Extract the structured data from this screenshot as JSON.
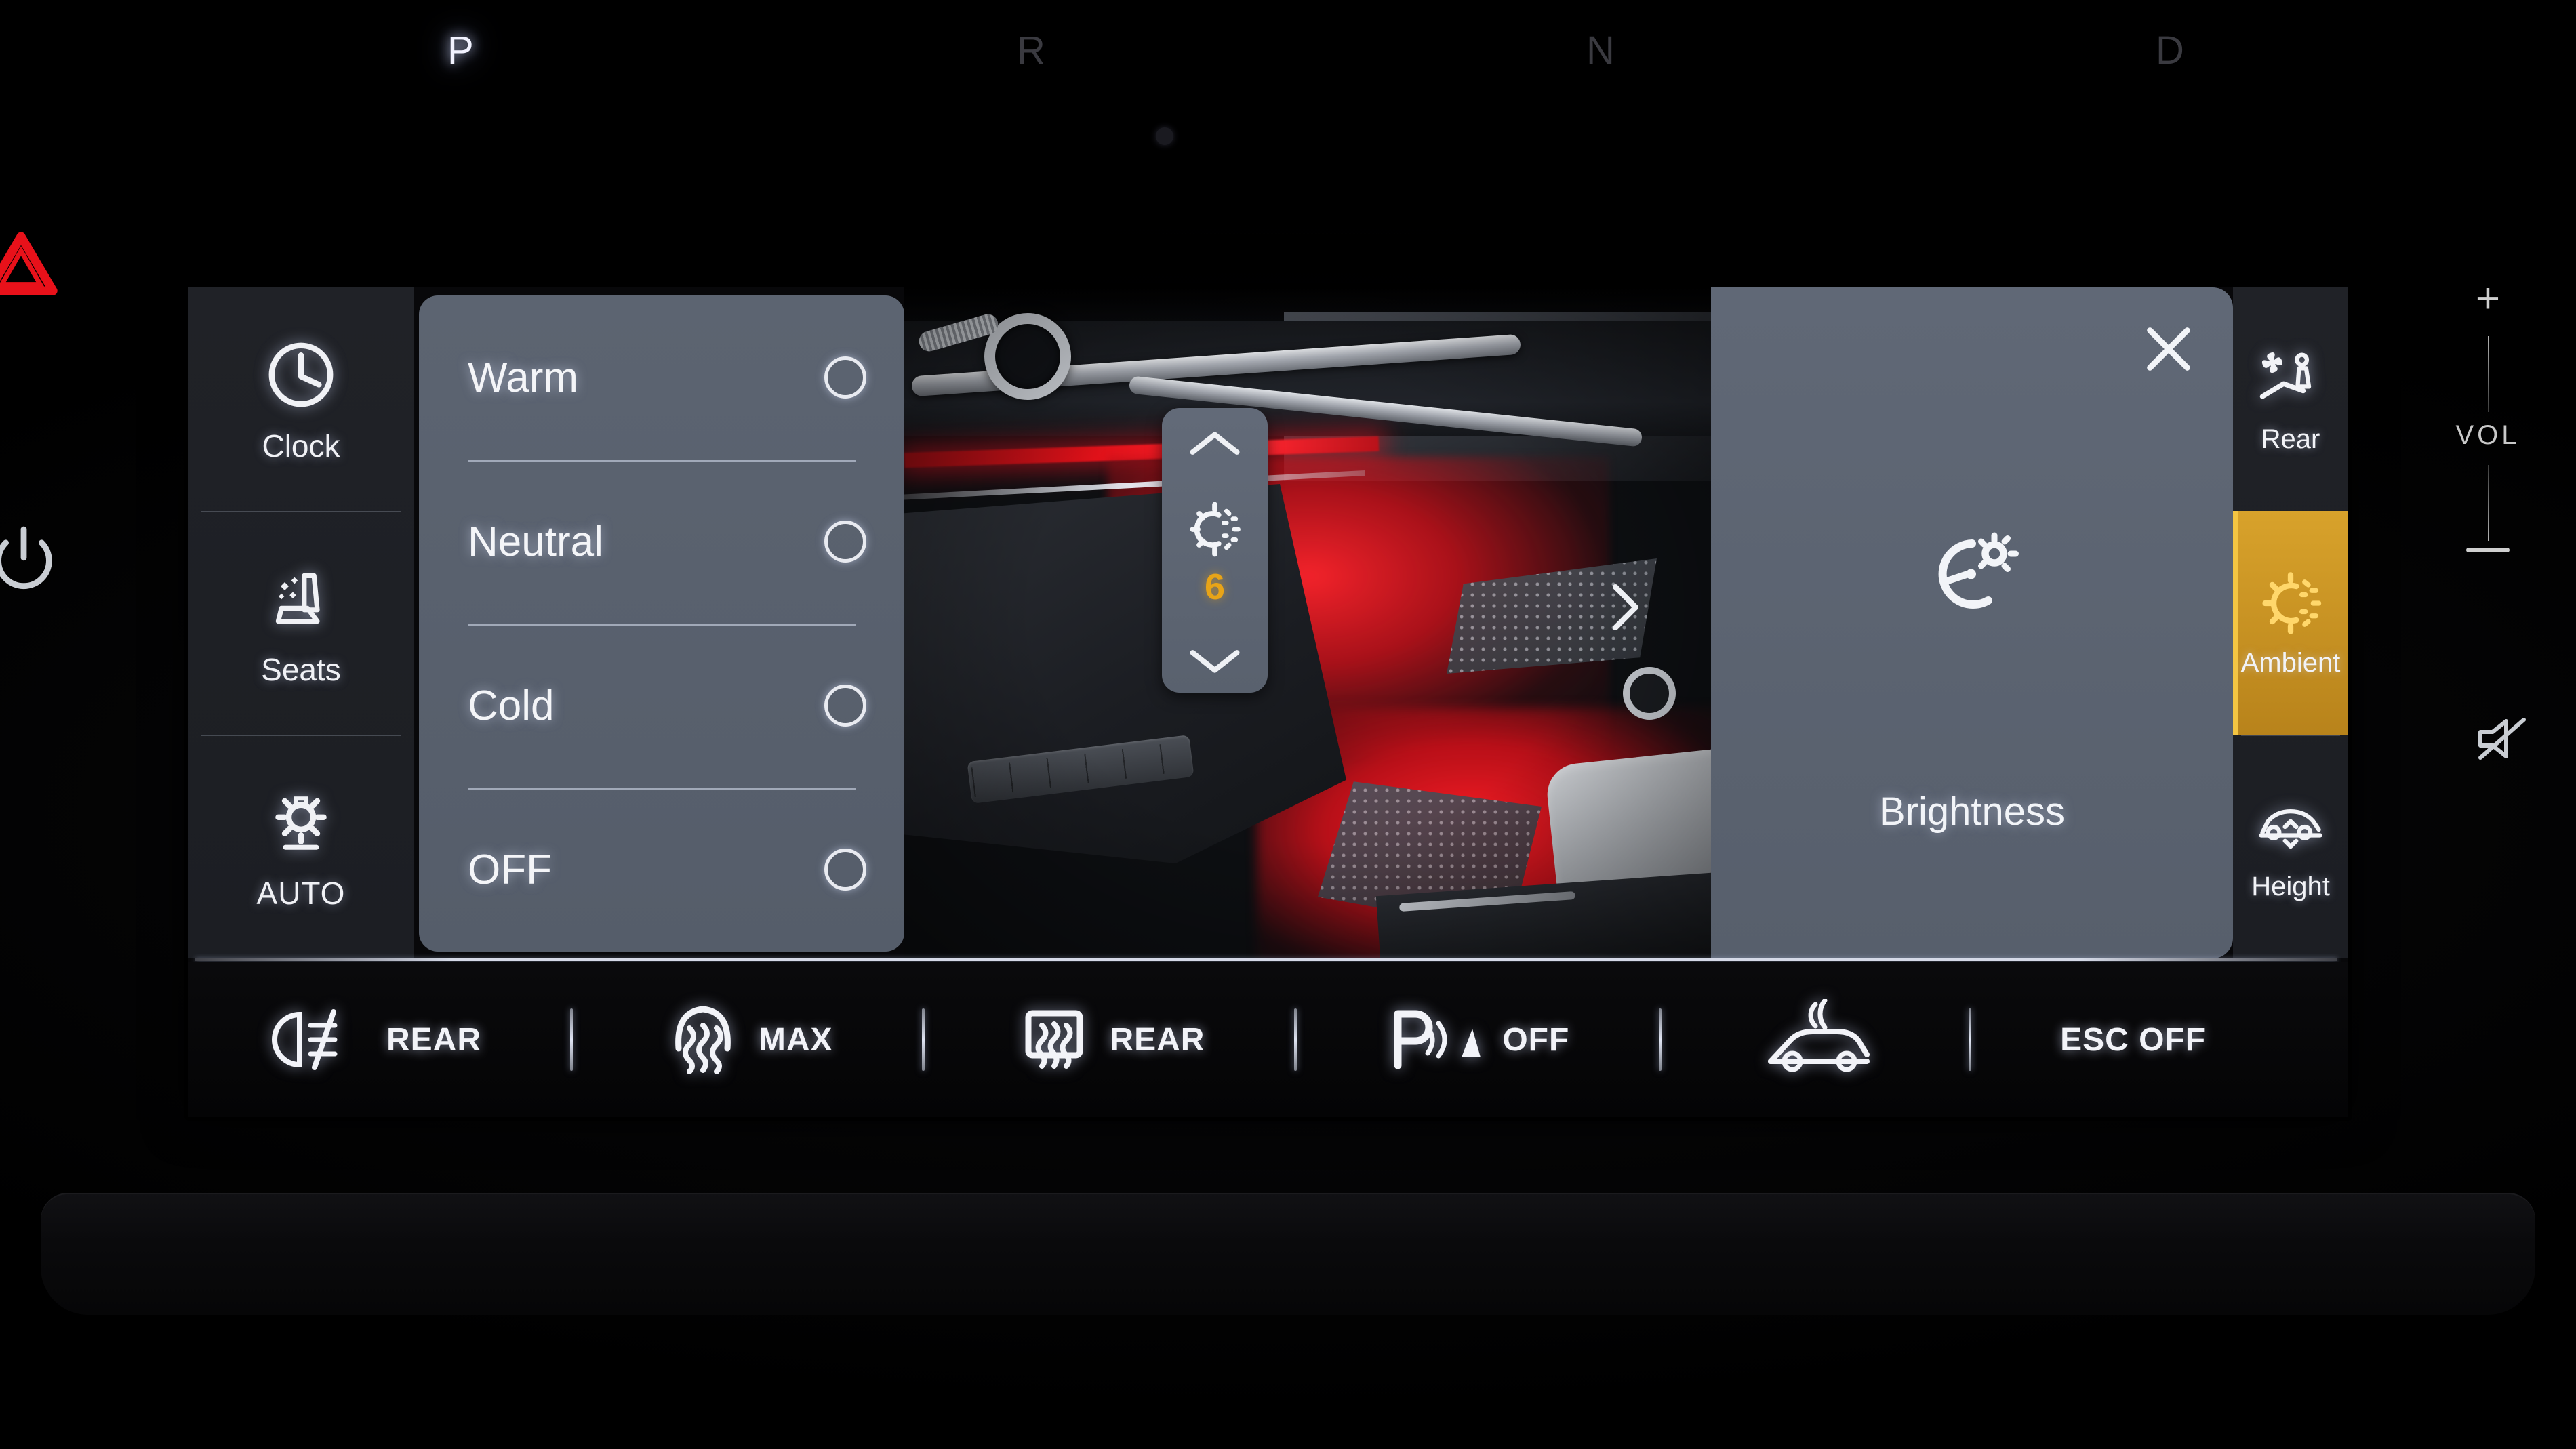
{
  "gear_selector": {
    "positions": [
      {
        "label": "P",
        "active": true
      },
      {
        "label": "R",
        "active": false
      },
      {
        "label": "N",
        "active": false
      },
      {
        "label": "D",
        "active": false
      }
    ]
  },
  "hard_keys": {
    "hazard": {
      "icon": "hazard-triangle-icon",
      "color": "#e8111a"
    },
    "power": {
      "icon": "power-icon"
    },
    "volume": {
      "plus": "+",
      "label": "VOL",
      "minus": "–"
    },
    "mute": {
      "icon": "mute-speaker-icon"
    }
  },
  "screen": {
    "left_rail": {
      "items": [
        {
          "label": "Clock",
          "icon": "clock-icon",
          "active": false
        },
        {
          "label": "Seats",
          "icon": "seat-climate-icon",
          "active": false
        },
        {
          "label": "AUTO",
          "icon": "brightness-auto-icon",
          "active": false
        }
      ]
    },
    "mode_list": {
      "options": [
        {
          "label": "Warm",
          "selected": false
        },
        {
          "label": "Neutral",
          "selected": false
        },
        {
          "label": "Cold",
          "selected": false
        },
        {
          "label": "OFF",
          "selected": false
        }
      ]
    },
    "preview": {
      "description": "Vehicle interior photo showing door trim and footwell with red ambient lighting",
      "ambient_color": "#ff1f28"
    },
    "brightness_stepper": {
      "increase_icon": "chevron-up-icon",
      "decrease_icon": "chevron-down-icon",
      "icon": "brightness-sun-icon",
      "value": "6",
      "value_color": "#e8a417"
    },
    "brightness_card": {
      "close_icon": "close-icon",
      "next_icon": "chevron-right-icon",
      "icon": "brightness-dial-icon",
      "label": "Brightness"
    },
    "right_rail": {
      "items": [
        {
          "label": "Rear",
          "icon": "rear-climate-icon",
          "active": false
        },
        {
          "label": "Ambient",
          "icon": "ambient-light-icon",
          "active": true,
          "accent": "#d8a22b"
        },
        {
          "label": "Height",
          "icon": "vehicle-height-icon",
          "active": false
        }
      ]
    },
    "bottom_bar": {
      "items": [
        {
          "label": "REAR",
          "icon": "rear-fog-light-icon"
        },
        {
          "label": "MAX",
          "icon": "front-defrost-icon"
        },
        {
          "label": "REAR",
          "icon": "rear-defrost-icon"
        },
        {
          "label": "OFF",
          "icon": "park-assist-icon"
        },
        {
          "label": "",
          "icon": "surround-camera-icon"
        },
        {
          "label": "ESC OFF",
          "icon": ""
        }
      ]
    }
  }
}
